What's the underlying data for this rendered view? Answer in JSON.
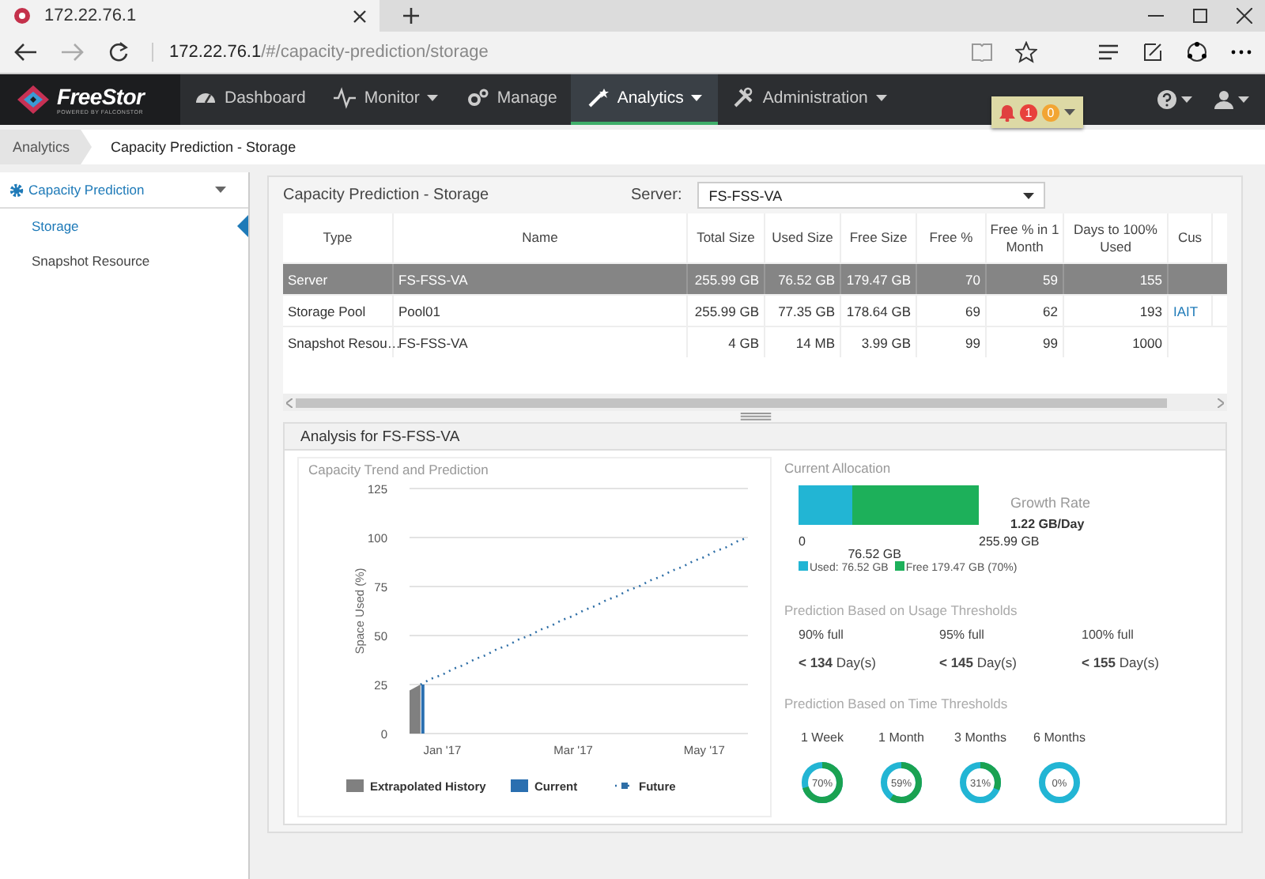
{
  "browser": {
    "tab_title": "172.22.76.1",
    "address_host": "172.22.76.1",
    "address_path": "/#/capacity-prediction/storage"
  },
  "navbar": {
    "logo": "FreeStor",
    "tagline": "POWERED BY FALCONSTOR",
    "items": [
      {
        "label": "Dashboard",
        "dropdown": false,
        "selected": false
      },
      {
        "label": "Monitor",
        "dropdown": true,
        "selected": false
      },
      {
        "label": "Manage",
        "dropdown": false,
        "selected": false
      },
      {
        "label": "Analytics",
        "dropdown": true,
        "selected": true
      },
      {
        "label": "Administration",
        "dropdown": true,
        "selected": false
      }
    ],
    "alerts": [
      {
        "count": "1",
        "color": "#e8413c"
      },
      {
        "count": "0",
        "color": "#f2a533"
      }
    ]
  },
  "breadcrumb": [
    "Analytics",
    "Capacity Prediction - Storage"
  ],
  "sidebar": {
    "section": "Capacity Prediction",
    "expanded": true,
    "items": [
      {
        "label": "Storage",
        "selected": true
      },
      {
        "label": "Snapshot Resource",
        "selected": false
      }
    ]
  },
  "panel": {
    "title": "Capacity Prediction - Storage",
    "server_label": "Server:",
    "server": "FS-FSS-VA"
  },
  "table": {
    "columns": [
      "Type",
      "Name",
      "Total Size",
      "Used Size",
      "Free Size",
      "Free %",
      "Free % in 1 Month",
      "Days to 100% Used",
      "Cus"
    ],
    "rows": [
      {
        "selected": true,
        "cells": [
          "Server",
          "FS-FSS-VA",
          "255.99 GB",
          "76.52 GB",
          "179.47 GB",
          "70",
          "59",
          "155"
        ]
      },
      {
        "selected": false,
        "cells": [
          "Storage Pool",
          "Pool01",
          "255.99 GB",
          "77.35 GB",
          "178.64 GB",
          "69",
          "62",
          "193",
          "IAIT"
        ]
      },
      {
        "selected": false,
        "cells": [
          "Snapshot Resou…",
          "FS-FSS-VA",
          "4 GB",
          "14 MB",
          "3.99 GB",
          "99",
          "99",
          "1000"
        ]
      }
    ]
  },
  "analysis": {
    "title": "Analysis for FS-FSS-VA",
    "trend": {
      "title": "Capacity Trend and Prediction",
      "chart_data": {
        "type": "line",
        "ylabel": "Space Used (%)",
        "categories": [
          null,
          null,
          null,
          "Jan '17",
          null,
          null,
          null,
          null,
          null,
          null,
          null,
          null,
          null,
          null,
          null,
          "Mar '17",
          null,
          null,
          null,
          null,
          null,
          null,
          null,
          null,
          null,
          null,
          null,
          "May '17",
          null,
          null,
          null,
          null
        ],
        "series": [
          {
            "name": "Extrapolated History",
            "type": "area",
            "color": "#808080",
            "values": [
              22,
              25,
              null,
              null,
              null,
              null,
              null,
              null,
              null,
              null,
              null,
              null,
              null,
              null,
              null,
              null,
              null,
              null,
              null,
              null,
              null,
              null,
              null,
              null,
              null,
              null,
              null,
              null,
              null,
              null,
              null,
              null
            ]
          },
          {
            "name": "Current",
            "type": "bar",
            "color": "#2a6fb0",
            "values": [
              null,
              25,
              null,
              null,
              null,
              null,
              null,
              null,
              null,
              null,
              null,
              null,
              null,
              null,
              null,
              null,
              null,
              null,
              null,
              null,
              null,
              null,
              null,
              null,
              null,
              null,
              null,
              null,
              null,
              null,
              null,
              null
            ]
          },
          {
            "name": "Future",
            "type": "line",
            "line_style": "dotted",
            "color": "#2e6ea6",
            "values": [
              null,
              25,
              28,
              30,
              33,
              35,
              38,
              40,
              43,
              45,
              48,
              50,
              53,
              55,
              58,
              60,
              63,
              65,
              68,
              70,
              73,
              75,
              78,
              80,
              83,
              85,
              88,
              90,
              93,
              95,
              98,
              100
            ]
          }
        ],
        "grid": true,
        "legend": true,
        "ylim": [
          0,
          125
        ],
        "yticks": [
          0,
          25,
          50,
          75,
          100,
          125
        ]
      }
    },
    "allocation": {
      "title": "Current Allocation",
      "level": 0.3,
      "start_label": "0",
      "used_label": "76.52 GB",
      "total_label": "255.99 GB",
      "legend": [
        {
          "label": "Used: 76.52 GB",
          "color": "#22b5d4"
        },
        {
          "label": "Free 179.47 GB (70%)",
          "color": "#1db05a"
        }
      ],
      "growth_title": "Growth Rate",
      "growth_value": "1.22 GB/Day"
    },
    "usage": {
      "title": "Prediction Based on Usage Thresholds",
      "items": [
        {
          "label": "90% full",
          "value": "**< 134** Day(s)"
        },
        {
          "label": "95% full",
          "value": "**< 145** Day(s)"
        },
        {
          "label": "100% full",
          "value": "**< 155** Day(s)"
        }
      ]
    },
    "time": {
      "title": "Prediction Based on Time Thresholds",
      "items": [
        {
          "label": "1 Week",
          "reading": "70%",
          "level": 0.7
        },
        {
          "label": "1 Month",
          "reading": "59%",
          "level": 0.59
        },
        {
          "label": "3 Months",
          "reading": "31%",
          "level": 0.31
        },
        {
          "label": "6 Months",
          "reading": "0%",
          "level": 0
        }
      ]
    }
  }
}
